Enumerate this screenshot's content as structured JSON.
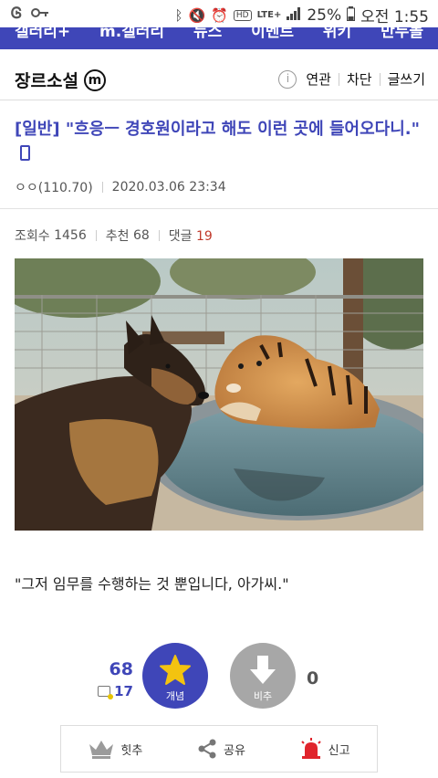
{
  "status_bar": {
    "battery": "25%",
    "time": "오전 1:55",
    "network": "LTE+",
    "icons": [
      "g-icon",
      "key-icon",
      "bluetooth-icon",
      "mute-icon",
      "alarm-icon",
      "hd-icon",
      "lte-icon",
      "signal-icon",
      "battery-icon"
    ]
  },
  "nav": {
    "items": [
      "갤러리+",
      "m.갤러리",
      "뉴스",
      "이벤트",
      "위키",
      "만두몰"
    ]
  },
  "gallery": {
    "title": "장르소설",
    "badge": "m",
    "actions": [
      "연관",
      "차단",
      "글쓰기"
    ]
  },
  "post": {
    "title": "[일반] \"흐응ㅡ 경호원이라고 해도 이런 곳에 들어오다니.\"",
    "author": "ㅇㅇ(110.70)",
    "date": "2020.03.06 23:34",
    "views_label": "조회수",
    "views": "1456",
    "recommend_label": "추천",
    "recommend": "68",
    "comments_label": "댓글",
    "comments": "19",
    "caption": "\"그저 임무를 수행하는 것 뿐입니다, 아가씨.\""
  },
  "votes": {
    "up_count": "68",
    "fixed_count": "17",
    "up_label": "개념",
    "down_label": "비추",
    "down_count": "0"
  },
  "bottom_actions": [
    {
      "icon": "crown-icon",
      "label": "힛추"
    },
    {
      "icon": "share-icon",
      "label": "공유"
    },
    {
      "icon": "siren-icon",
      "label": "신고"
    }
  ],
  "colors": {
    "accent": "#3f46b8",
    "comment_red": "#c0392b",
    "downvote_gray": "#a7a7a7"
  }
}
